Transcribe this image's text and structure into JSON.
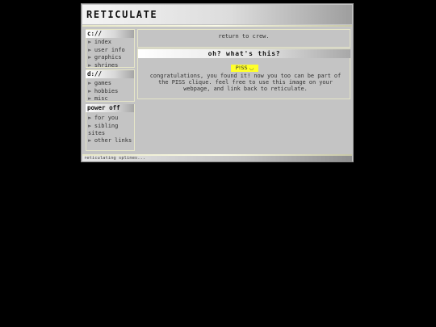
{
  "site": {
    "title": "RETICULATE"
  },
  "sidebar": {
    "sections": [
      {
        "heading": "c://",
        "items": [
          "index",
          "user info",
          "graphics",
          "shrines"
        ]
      },
      {
        "heading": "d://",
        "items": [
          "games",
          "hobbies",
          "misc"
        ]
      },
      {
        "heading": "power off",
        "items": [
          "for you",
          "sibling sites",
          "other links"
        ]
      }
    ],
    "bullet": "⊳"
  },
  "main": {
    "return_link": "return to crew.",
    "heading": "oh? what's this?",
    "badge": "P!SS ◡",
    "body": "congratulations, you found it! now you too can be part of the PISS clique. feel free to use this image on your webpage, and link back to reticulate."
  },
  "footer": {
    "text": "reticulating splines..."
  },
  "colors": {
    "badge": "#ffff2a",
    "panel": "#c4c4c4",
    "background": "#000000"
  }
}
